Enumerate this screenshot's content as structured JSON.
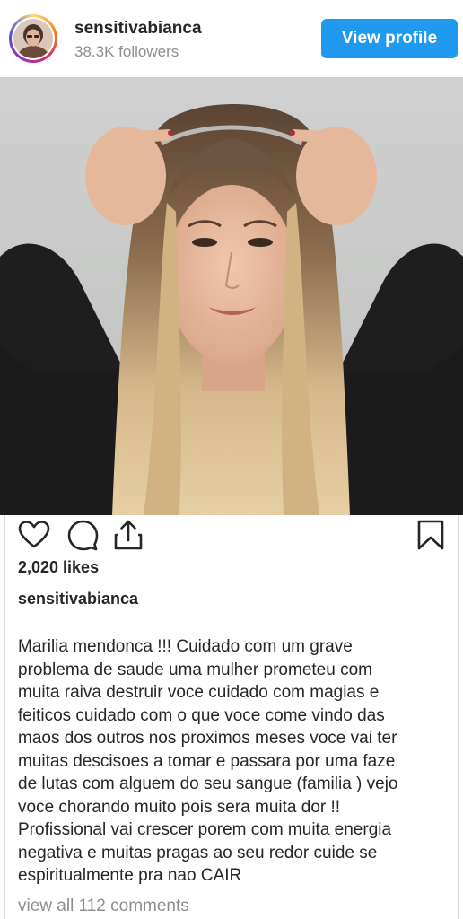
{
  "header": {
    "username": "sensitivabianca",
    "followers": "38.3K followers",
    "view_profile_label": "View profile"
  },
  "post": {
    "likes": "2,020 likes",
    "caption_user": "sensitivabianca",
    "caption_lines": [
      "Marilia mendonca !!! Cuidado com um grave",
      "problema de saude uma mulher prometeu com",
      "muita raiva destruir voce cuidado com magias e",
      "feiticos cuidado com o que voce come vindo das",
      "maos dos outros nos proximos meses voce vai ter",
      "muitas descisoes a tomar e passara por uma faze",
      "de lutas com alguem do seu sangue (familia ) vejo",
      "voce chorando muito pois sera muita dor !!",
      "Profissional vai crescer porem com muita energia",
      "negativa e muitas pragas ao seu redor cuide se",
      "espiritualmente pra nao CAIR"
    ],
    "view_comments": "view all 112 comments"
  },
  "icons": {
    "like": "heart-icon",
    "comment": "comment-icon",
    "share": "share-icon",
    "save": "bookmark-icon"
  },
  "colors": {
    "accent": "#1f9aee",
    "text": "#262626",
    "muted": "#8e8e8e"
  }
}
